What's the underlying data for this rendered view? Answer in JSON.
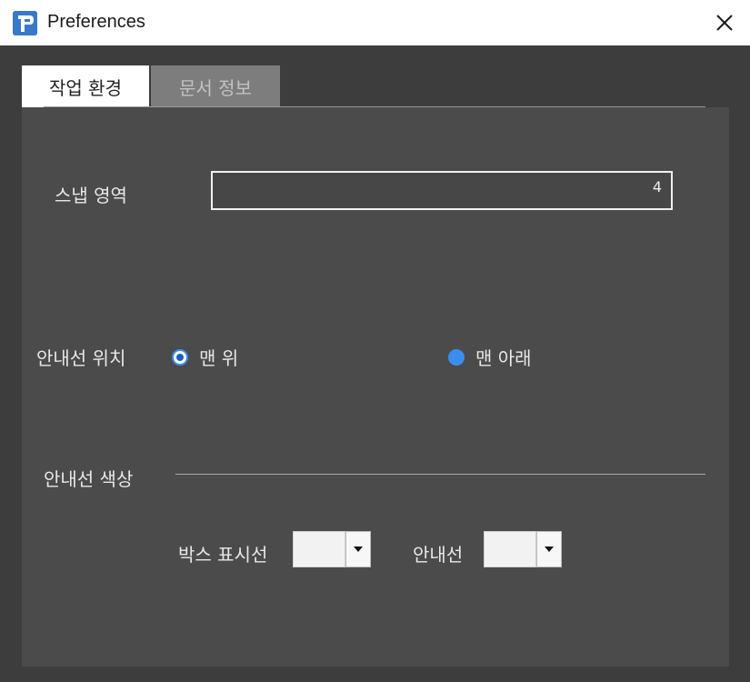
{
  "window": {
    "title": "Preferences",
    "app_icon": "p-app-icon",
    "close_icon": "close-icon"
  },
  "tabs": [
    {
      "label": "작업 환경",
      "active": true
    },
    {
      "label": "문서 정보",
      "active": false
    }
  ],
  "snap": {
    "label": "스냅 영역",
    "value": "4"
  },
  "guide_position": {
    "label": "안내선 위치",
    "options": [
      {
        "label": "맨 위",
        "selected": true
      },
      {
        "label": "맨 아래",
        "selected": false
      }
    ]
  },
  "guide_color": {
    "section_label": "안내선 색상",
    "box_label": "박스 표시선",
    "guide_label": "안내선",
    "box_color": "#f2f2f2",
    "guide_color": "#f2f2f2"
  },
  "colors": {
    "accent": "#3b8ef0",
    "panel": "#4b4b4b",
    "background": "#3d3d3d"
  }
}
